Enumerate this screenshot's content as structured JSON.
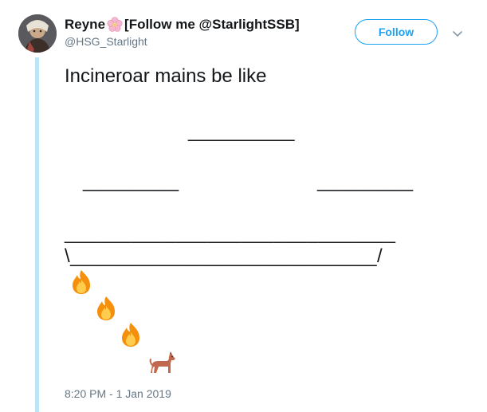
{
  "tweet": {
    "author_name": "Reyne",
    "author_name_suffix": "[Follow me @StarlightSSB]",
    "author_emoji_icon": "cherry-blossom-icon",
    "handle": "@HSG_Starlight",
    "follow_label": "Follow",
    "text": "Incineroar mains be like",
    "timestamp": "8:20 PM - 1 Jan 2019"
  },
  "ascii_art": {
    "line1": "__________",
    "line2_left": "_________",
    "line2_right": "_________",
    "line3": "______________________________",
    "line4": "\\____________________________/"
  },
  "emoji_sequence": [
    "fire-icon",
    "fire-icon",
    "fire-icon",
    "dog-icon"
  ],
  "colors": {
    "accent": "#1da1f2",
    "thread_line": "#bde6f5",
    "secondary_text": "#657786"
  }
}
